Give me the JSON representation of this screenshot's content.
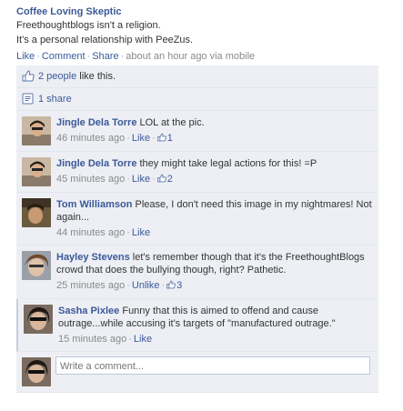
{
  "post": {
    "author": "Coffee Loving Skeptic",
    "lines": [
      "Freethoughtblogs isn't a religion.",
      "It's a personal relationship with PeeZus."
    ],
    "actions": {
      "like": "Like",
      "comment": "Comment",
      "share": "Share",
      "time": "about an hour ago via mobile"
    }
  },
  "likes": {
    "people_link": "2 people",
    "suffix": " like this."
  },
  "shares": {
    "label": "1 share"
  },
  "comments": [
    {
      "name": "Jingle Dela Torre",
      "text": "LOL at the pic.",
      "time": "46 minutes ago",
      "action": "Like",
      "likes": "1"
    },
    {
      "name": "Jingle Dela Torre",
      "text": "they might take legal actions for this! =P",
      "time": "45 minutes ago",
      "action": "Like",
      "likes": "2"
    },
    {
      "name": "Tom Williamson",
      "text": "Please, I don't need this image in my nightmares! Not again...",
      "time": "44 minutes ago",
      "action": "Like",
      "likes": ""
    },
    {
      "name": "Hayley Stevens",
      "text": "let's remember though that it's the FreethoughtBlogs crowd that does the bullying though, right? Pathetic.",
      "time": "25 minutes ago",
      "action": "Unlike",
      "likes": "3"
    },
    {
      "name": "Sasha Pixlee",
      "text": "Funny that this is aimed to offend and cause outrage...while accusing it's targets of \"manufactured outrage.\"",
      "time": "15 minutes ago",
      "action": "Like",
      "likes": ""
    }
  ],
  "write_comment": {
    "placeholder": "Write a comment..."
  },
  "colors": {
    "link": "#3b5998",
    "ufi_bg": "#edeff4",
    "meta": "#8a8a8a"
  }
}
